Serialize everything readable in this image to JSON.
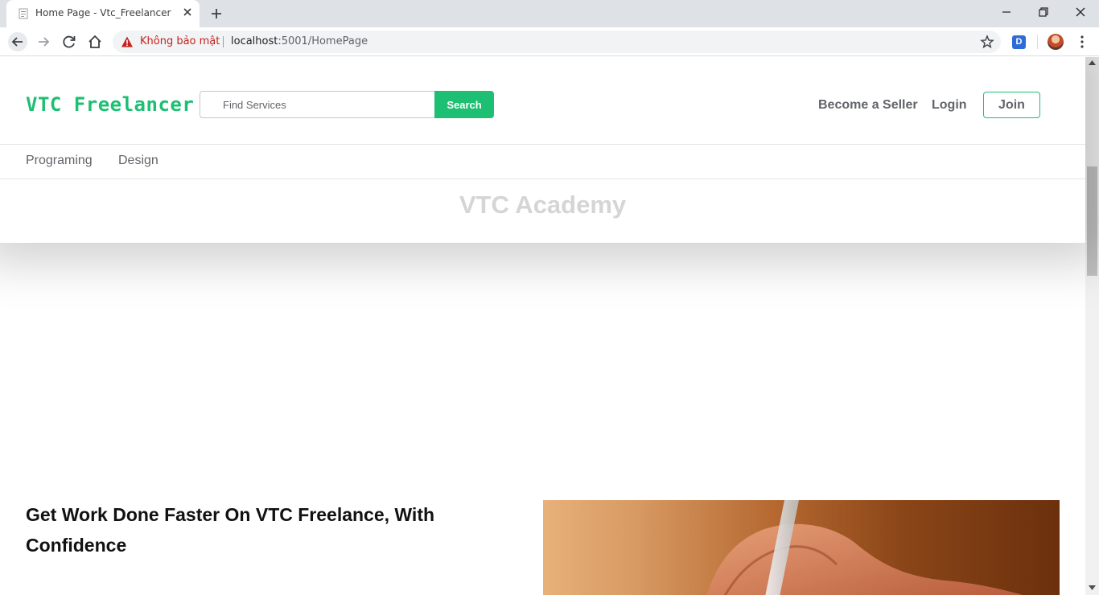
{
  "browser": {
    "tab_title": "Home Page - Vtc_Freelancer",
    "security_warning": "Không bảo mật",
    "url_host": "localhost",
    "url_rest": ":5001/HomePage",
    "extension_label": "D"
  },
  "header": {
    "logo": "VTC Freelancer",
    "search": {
      "placeholder": "Find Services",
      "button": "Search"
    },
    "nav": {
      "become_seller": "Become a Seller",
      "login": "Login",
      "join": "Join"
    }
  },
  "categories": [
    "Programing",
    "Design"
  ],
  "banner": "VTC Academy",
  "hero": {
    "title": "Get Work Done Faster On VTC Freelance, With Confidence"
  }
}
